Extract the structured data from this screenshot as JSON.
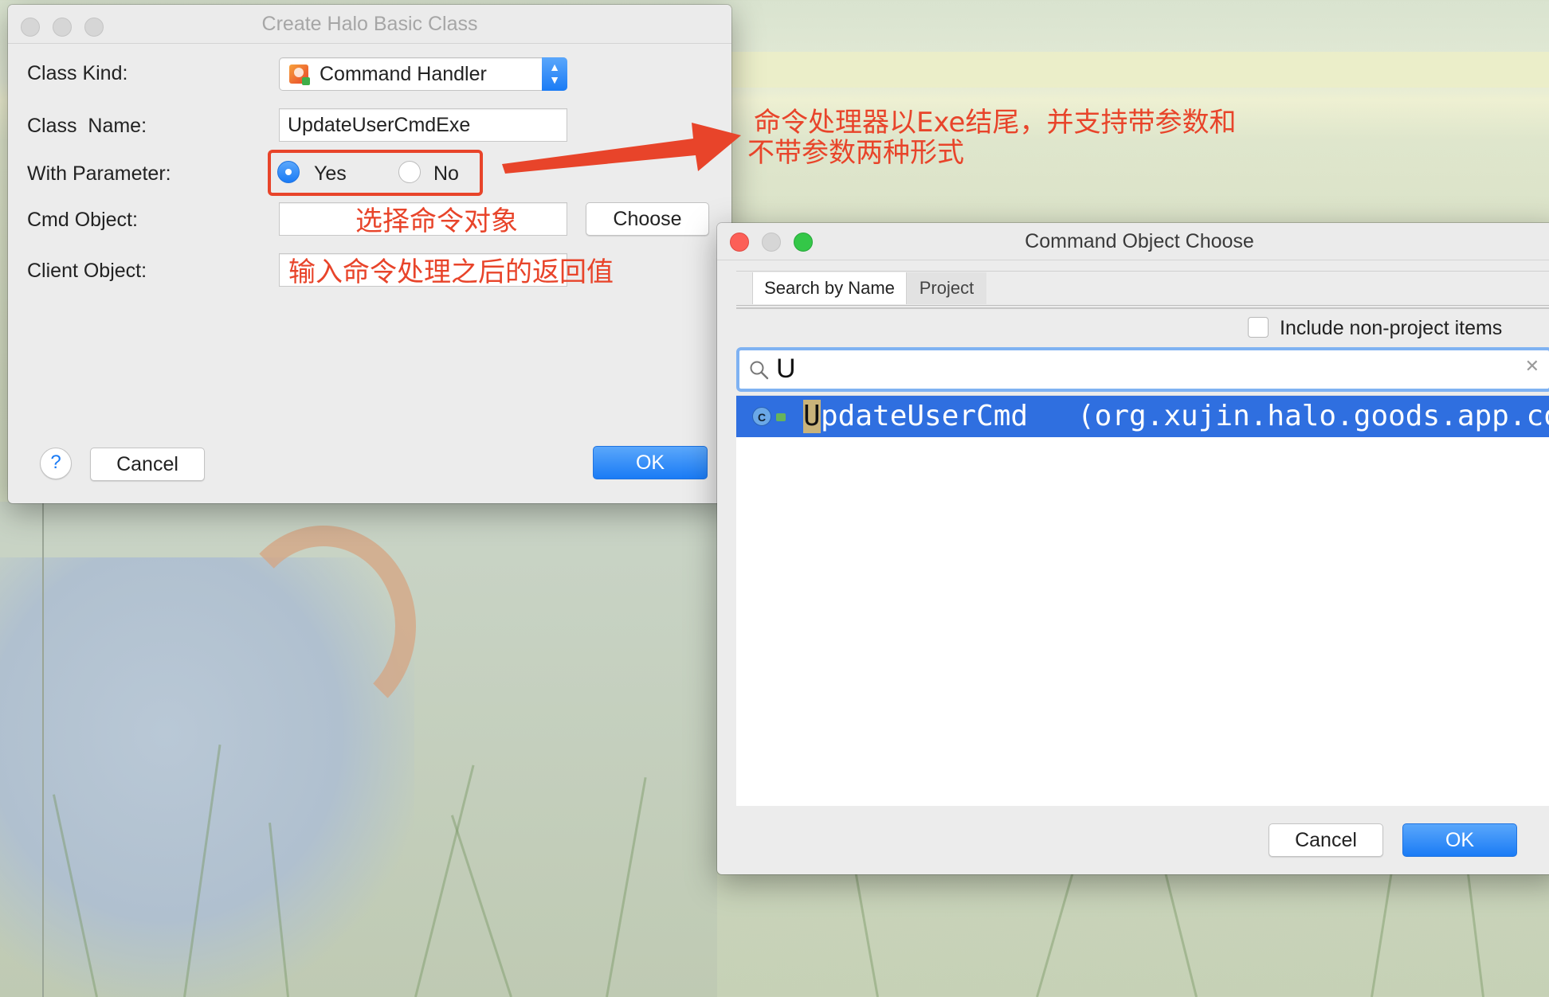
{
  "colors": {
    "accent_red": "#e8442a",
    "selection_blue": "#2f6fe0",
    "ok_blue": "#1a7bf5"
  },
  "create_dialog": {
    "title": "Create Halo Basic Class",
    "class_kind_label": "Class Kind:",
    "class_kind_value": "Command Handler",
    "class_kind_icon": "command-handler-icon",
    "class_name_label": "Class  Name:",
    "class_name_value": "UpdateUserCmdExe",
    "with_parameter_label": "With Parameter:",
    "radio_yes_label": "Yes",
    "radio_no_label": "No",
    "selected_option": "Yes",
    "cmd_object_label": "Cmd Object:",
    "cmd_object_value": "",
    "choose_button": "Choose",
    "client_object_label": "Client Object:",
    "client_object_value": "",
    "help_button": "?",
    "cancel_button": "Cancel",
    "ok_button": "OK"
  },
  "annotations": {
    "top_line1": "命令处理器以Exe结尾，并支持带参数和",
    "top_line2": "不带参数两种形式",
    "cmd_object_hint": "选择命令对象",
    "client_object_hint": "输入命令处理之后的返回值"
  },
  "chooser_dialog": {
    "title": "Command Object Choose",
    "tabs": [
      "Search by Name",
      "Project"
    ],
    "active_tab": "Search by Name",
    "include_checkbox_label": "Include non-project items",
    "include_checked": false,
    "search_value": "U",
    "results": [
      {
        "match": "U",
        "rest": "pdateUserCmd",
        "package": "(org.xujin.halo.goods.app.com"
      }
    ],
    "cancel_button": "Cancel",
    "ok_button": "OK"
  }
}
